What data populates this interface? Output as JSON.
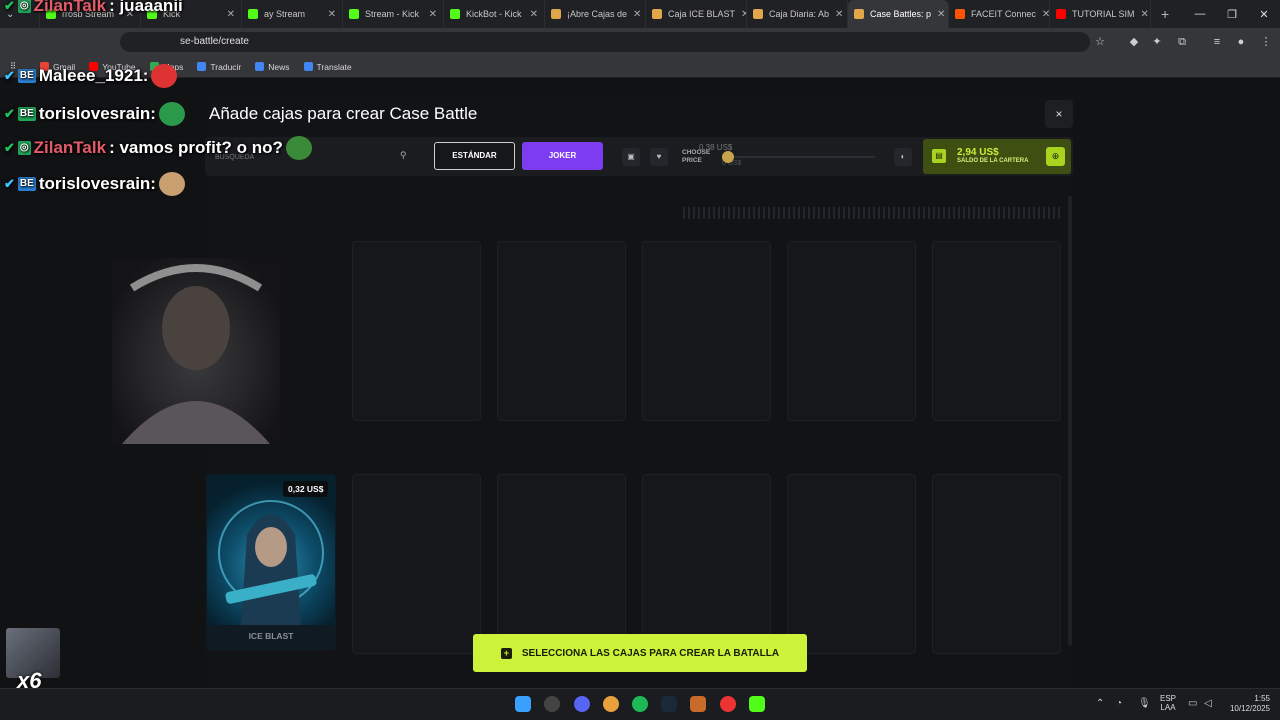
{
  "browser": {
    "tabs": [
      {
        "label": "rrosb Stream",
        "color": "#53fc18"
      },
      {
        "label": "Kick",
        "color": "#53fc18"
      },
      {
        "label": "ay Stream",
        "color": "#53fc18"
      },
      {
        "label": "Stream - Kick",
        "color": "#53fc18"
      },
      {
        "label": "KickBot - Kick",
        "color": "#53fc18"
      },
      {
        "label": "¡Abre Cajas de",
        "color": "#e0a64a"
      },
      {
        "label": "Caja ICE BLAST",
        "color": "#e0a64a"
      },
      {
        "label": "Caja Diaria: Ab",
        "color": "#e0a64a"
      },
      {
        "label": "Case Battles: p",
        "color": "#e0a64a",
        "active": true
      },
      {
        "label": "FACEIT Connec",
        "color": "#ff5500"
      },
      {
        "label": "TUTORIAL SIM",
        "color": "#ff0000"
      }
    ],
    "new_tab": "+",
    "url": "se-battle/create",
    "bookmarks": [
      {
        "label": "Gmail",
        "color": "#ea4335"
      },
      {
        "label": "YouTube",
        "color": "#ff0000"
      },
      {
        "label": "Maps",
        "color": "#34a853"
      },
      {
        "label": "Traducir",
        "color": "#4285f4"
      },
      {
        "label": "News",
        "color": "#4285f4"
      },
      {
        "label": "Translate",
        "color": "#4285f4"
      }
    ]
  },
  "modal": {
    "title": "Añade cajas para crear Case Battle",
    "close": "×",
    "search_placeholder": "BÚSQUEDA",
    "mode_standard": "ESTÁNDAR",
    "mode_joker": "JOKER",
    "choose_price": "CHOOSE PRICE",
    "price_max": "0,38 US$",
    "price_min": "0 US$",
    "price_level": 0.0,
    "wallet_amount": "2,94 US$",
    "wallet_label": "SALDO DE LA CARTERA",
    "accent": "#ccf23a",
    "joker_color": "#7d3cf0"
  },
  "case": {
    "price": "0,32 US$",
    "name": "ICE BLAST"
  },
  "cta": {
    "icon": "+",
    "label": "SELECCIONA LAS CAJAS PARA CREAR LA BATALLA"
  },
  "overlay": {
    "chat": [
      {
        "user": "ZilanTalk",
        "message": ": juaaanii",
        "verified": "green"
      },
      {
        "user": "Maleee_1921:",
        "message": "",
        "verified": "blue"
      },
      {
        "user": "torislovesrain:",
        "message": "",
        "verified": "blue"
      },
      {
        "user": "ZilanTalk",
        "message": ": vamos profit? o no?",
        "verified": "green"
      },
      {
        "user": "torislovesrain:",
        "message": "",
        "verified": "blue"
      }
    ],
    "viewer_count": "x6"
  },
  "taskbar": {
    "lang": "ESP",
    "lang_sub": "LAA",
    "time": "1:55",
    "date": "10/12/2025"
  }
}
